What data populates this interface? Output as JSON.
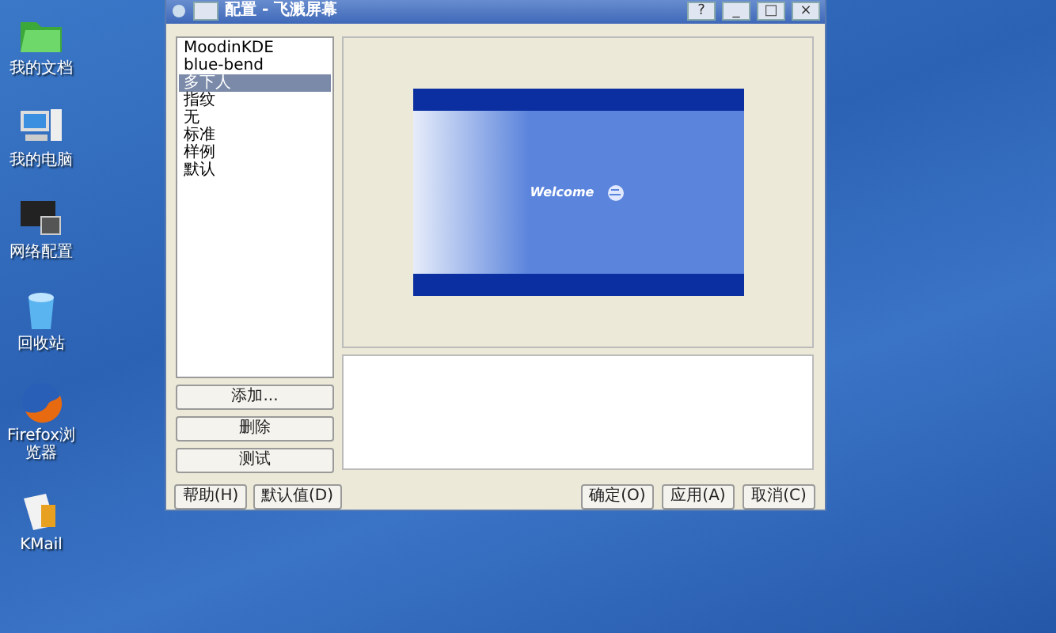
{
  "desktop_icons": [
    {
      "kind": "folder",
      "label": "我的文档"
    },
    {
      "kind": "computer",
      "label": "我的电脑"
    },
    {
      "kind": "network",
      "label": "网络配置"
    },
    {
      "kind": "trash",
      "label": "回收站"
    },
    {
      "kind": "browser",
      "label": "Firefox浏览器"
    },
    {
      "kind": "mail",
      "label": "KMail"
    }
  ],
  "window": {
    "title": "配置 - 飞溅屏幕",
    "title_buttons": [
      "?",
      "_",
      "□",
      "×"
    ]
  },
  "themes": [
    {
      "label": "MoodinKDE",
      "selected": false
    },
    {
      "label": "blue-bend",
      "selected": false
    },
    {
      "label": "多下人",
      "selected": true
    },
    {
      "label": "指纹",
      "selected": false
    },
    {
      "label": "无",
      "selected": false
    },
    {
      "label": "标准",
      "selected": false
    },
    {
      "label": "样例",
      "selected": false
    },
    {
      "label": "默认",
      "selected": false
    }
  ],
  "preview": {
    "text": "Welcome"
  },
  "side_buttons": [
    "添加...",
    "删除",
    "测试"
  ],
  "footer_left": [
    "帮助(H)",
    "默认值(D)"
  ],
  "footer_right": [
    "确定(O)",
    "应用(A)",
    "取消(C)"
  ]
}
